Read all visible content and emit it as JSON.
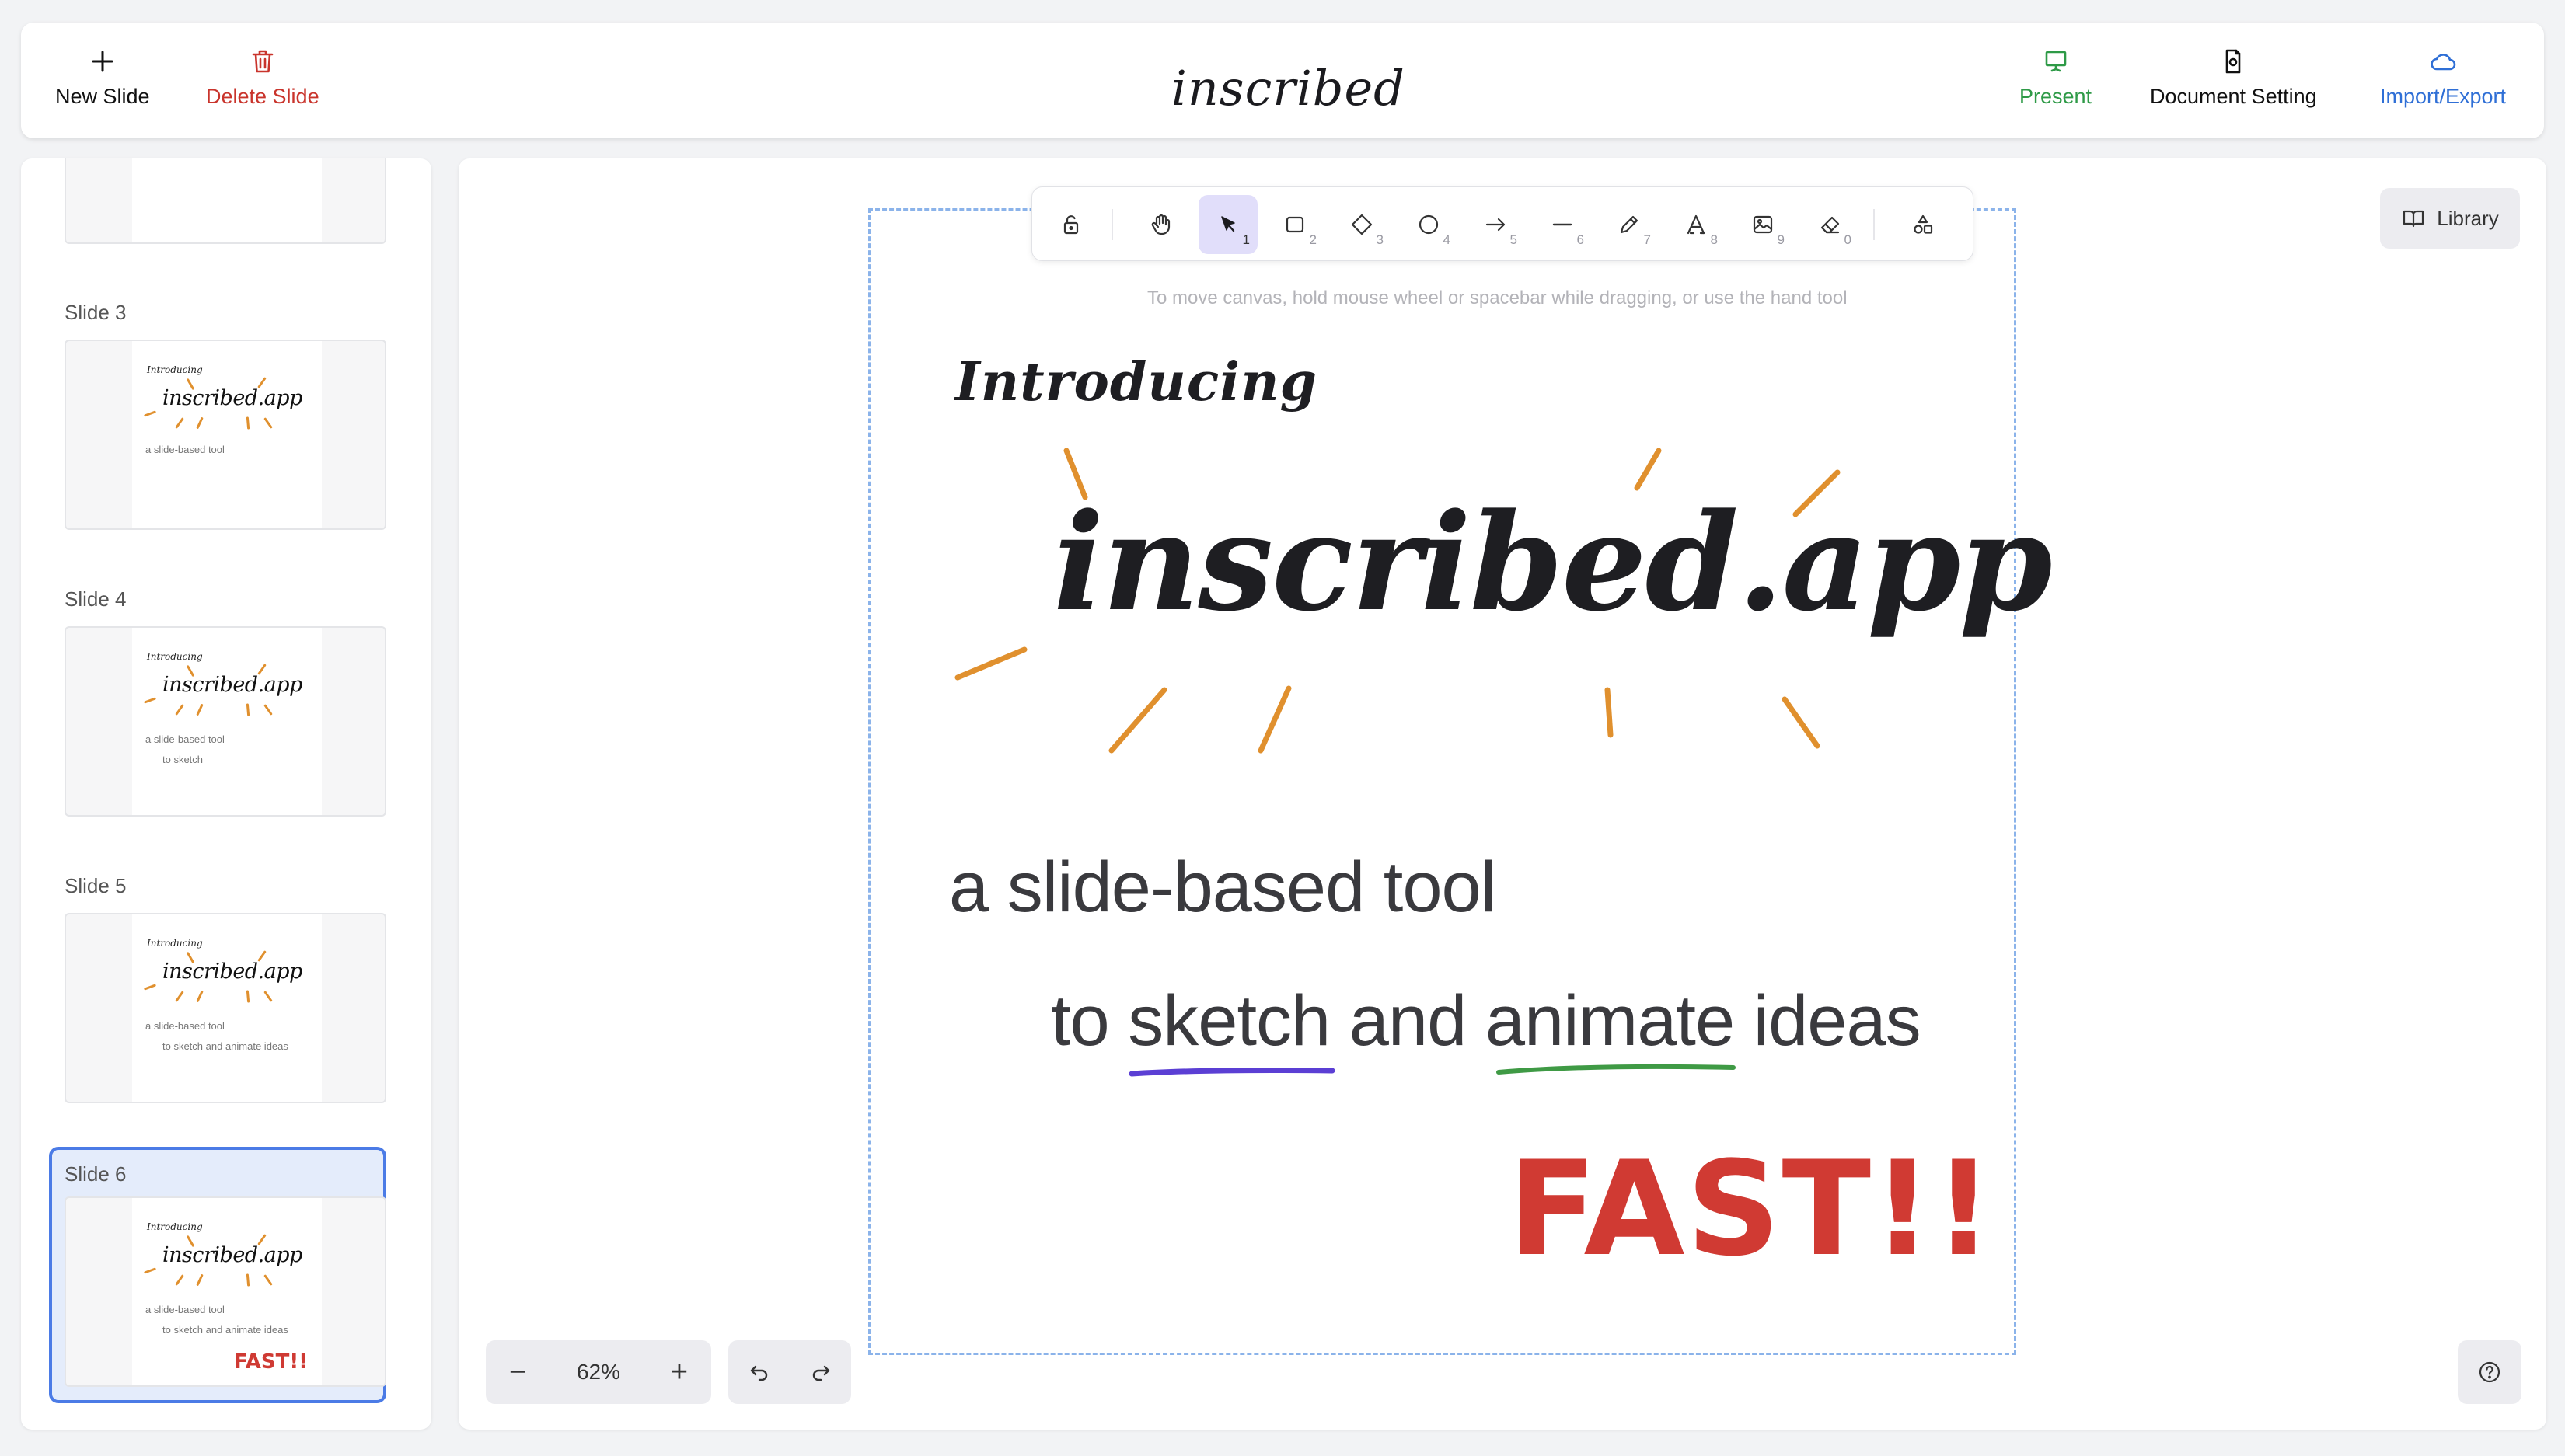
{
  "header": {
    "new_slide": "New Slide",
    "delete_slide": "Delete Slide",
    "logo": "inscribed",
    "present": "Present",
    "document_setting": "Document Setting",
    "import_export": "Import/Export"
  },
  "sidebar": {
    "slides": [
      {
        "label": "Slide 3",
        "intro": "Introducing",
        "title": "inscribed.app",
        "sub": "a slide-based tool"
      },
      {
        "label": "Slide 4",
        "intro": "Introducing",
        "title": "inscribed.app",
        "sub": "a slide-based tool",
        "line2": "to sketch"
      },
      {
        "label": "Slide 5",
        "intro": "Introducing",
        "title": "inscribed.app",
        "sub": "a slide-based tool",
        "line2": "to sketch and animate ideas"
      },
      {
        "label": "Slide 6",
        "intro": "Introducing",
        "title": "inscribed.app",
        "sub": "a slide-based tool",
        "line2": "to sketch and animate ideas",
        "fast": "FAST!!",
        "selected": true
      }
    ]
  },
  "toolbar": {
    "tools": [
      {
        "name": "lock",
        "key": ""
      },
      {
        "name": "hand",
        "key": ""
      },
      {
        "name": "selection",
        "key": "1",
        "active": true
      },
      {
        "name": "rectangle",
        "key": "2"
      },
      {
        "name": "diamond",
        "key": "3"
      },
      {
        "name": "ellipse",
        "key": "4"
      },
      {
        "name": "arrow",
        "key": "5"
      },
      {
        "name": "line",
        "key": "6"
      },
      {
        "name": "draw",
        "key": "7"
      },
      {
        "name": "text",
        "key": "8"
      },
      {
        "name": "image",
        "key": "9"
      },
      {
        "name": "eraser",
        "key": "0"
      },
      {
        "name": "more-shapes",
        "key": ""
      }
    ]
  },
  "canvas": {
    "hint": "To move canvas, hold mouse wheel or spacebar while dragging, or use the hand tool",
    "intro": "Introducing",
    "title": "inscribed.app",
    "subtitle": "a slide-based tool",
    "line2_to": "to",
    "line2_sketch": "sketch",
    "line2_and": "and",
    "line2_animate": "animate",
    "line2_ideas": "ideas",
    "fast": "FAST!!",
    "colors": {
      "rays": "#e0902e",
      "sketch_underline": "#5b3fd4",
      "animate_underline": "#3f9a45",
      "fast": "#d03a33"
    }
  },
  "library": "Library",
  "zoom": {
    "minus": "−",
    "value": "62%",
    "plus": "+"
  }
}
